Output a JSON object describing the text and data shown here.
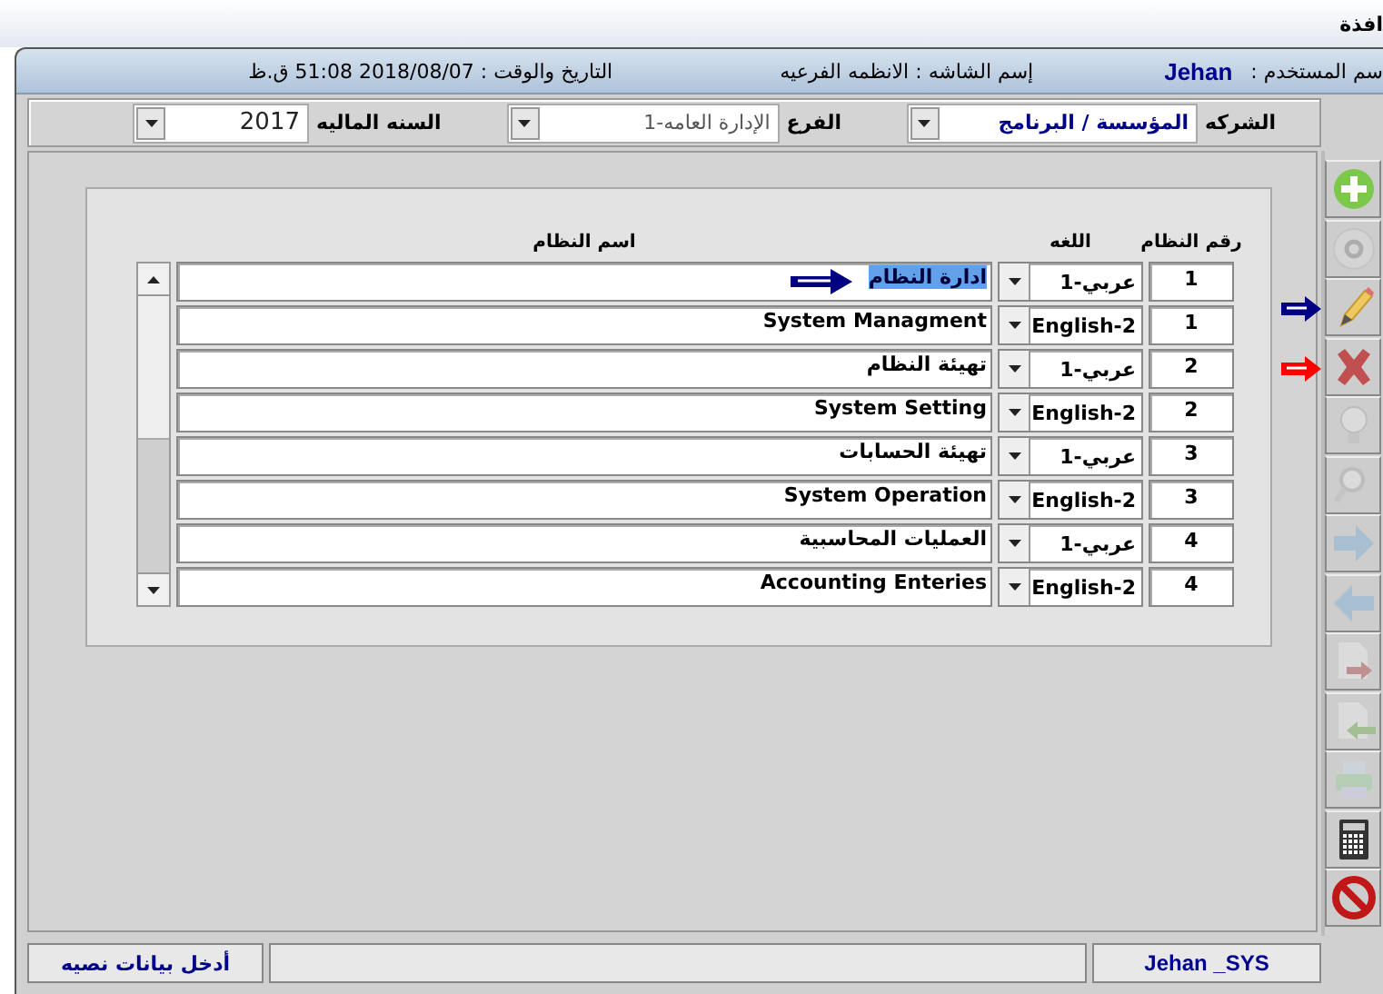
{
  "window": {
    "title": "افذة"
  },
  "header": {
    "user_label": "سم المستخدم :",
    "user_name": "Jehan",
    "screen_name": "إسم الشاشه : الانظمه الفرعيه",
    "datetime": "التاريخ والوقت : 2018/08/07  51:08 ق.ظ"
  },
  "filters": [
    {
      "label": "الشركه",
      "value": "المؤسسة / البرنامج",
      "kind": "company"
    },
    {
      "label": "الفرع",
      "value": "1-الإدارة العامه",
      "kind": "branch"
    },
    {
      "label": "السنه الماليه",
      "value": "2017",
      "kind": "year"
    }
  ],
  "table": {
    "columns": [
      "رقم النظام",
      "اللغه",
      "اسم النظام"
    ],
    "rows": [
      {
        "number": "1",
        "language": "1-عربي",
        "name": "ادارة النظام",
        "selected": true,
        "pointer": true
      },
      {
        "number": "1",
        "language": "English-2",
        "name": "System Managment",
        "selected": false,
        "pointer": false
      },
      {
        "number": "2",
        "language": "1-عربي",
        "name": "تهيئة النظام",
        "selected": false,
        "pointer": false
      },
      {
        "number": "2",
        "language": "English-2",
        "name": "System Setting",
        "selected": false,
        "pointer": false
      },
      {
        "number": "3",
        "language": "1-عربي",
        "name": "تهيئة الحسابات",
        "selected": false,
        "pointer": false
      },
      {
        "number": "3",
        "language": "English-2",
        "name": "System Operation",
        "selected": false,
        "pointer": false
      },
      {
        "number": "4",
        "language": "1-عربي",
        "name": "العمليات المحاسبية",
        "selected": false,
        "pointer": false
      },
      {
        "number": "4",
        "language": "English-2",
        "name": "Accounting Enteries",
        "selected": false,
        "pointer": false
      }
    ]
  },
  "toolbar": [
    {
      "kind": "add",
      "disabled": false
    },
    {
      "kind": "save",
      "disabled": true
    },
    {
      "kind": "edit",
      "disabled": false,
      "color": "#000080"
    },
    {
      "kind": "delete",
      "disabled": false,
      "color": "#ff0000"
    },
    {
      "kind": "hint",
      "disabled": true
    },
    {
      "kind": "search",
      "disabled": true
    },
    {
      "kind": "next",
      "disabled": true
    },
    {
      "kind": "previous",
      "disabled": true
    },
    {
      "kind": "export",
      "disabled": true
    },
    {
      "kind": "import",
      "disabled": true
    },
    {
      "kind": "print",
      "disabled": true
    },
    {
      "kind": "calculator",
      "disabled": false
    },
    {
      "kind": "close",
      "disabled": false
    }
  ],
  "status_bar": {
    "user": "Jehan _SYS",
    "message": "أدخل بيانات نصيه"
  }
}
